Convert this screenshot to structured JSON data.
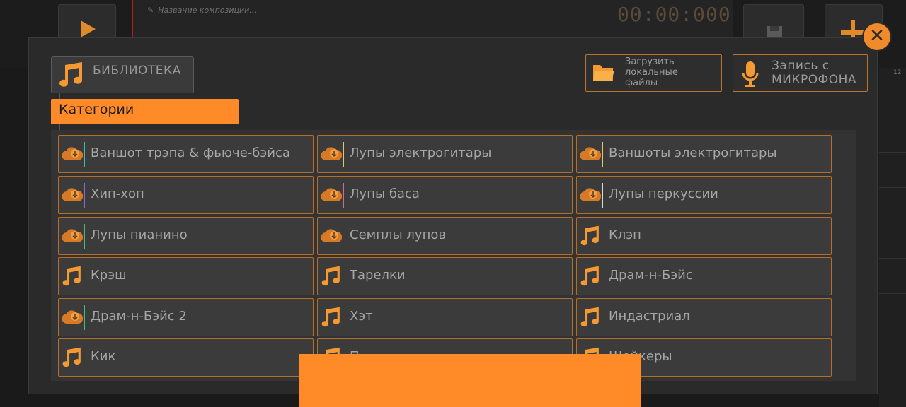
{
  "background": {
    "composition_placeholder": "Название композиции...",
    "timer": "00:00:000",
    "ruler_label": "12"
  },
  "toolbar": {
    "library_label": "БИБЛИОТЕКА",
    "load_label": "Загрузить\nлокальные\nфайлы",
    "mic_label": "Запись с\nМИКРОФОНА",
    "close_icon": "close-icon"
  },
  "categories_header": "Категории",
  "categories": [
    {
      "label": "Ваншот трэпа & фьюче-бэйса",
      "icon": "cloud-download-icon",
      "accent": "#3fb8a6"
    },
    {
      "label": "Лупы электрогитары",
      "icon": "cloud-download-icon",
      "accent": "#e0c860"
    },
    {
      "label": "Ваншоты электрогитары",
      "icon": "cloud-download-icon",
      "accent": "#e0c860"
    },
    {
      "label": "Хип-хоп",
      "icon": "cloud-download-icon",
      "accent": "#8a6cc8"
    },
    {
      "label": "Лупы баса",
      "icon": "cloud-download-icon",
      "accent": "#d06a9a"
    },
    {
      "label": "Лупы перкуссии",
      "icon": "cloud-download-icon",
      "accent": "#d8d8d8"
    },
    {
      "label": "Лупы пианино",
      "icon": "cloud-download-icon",
      "accent": "#4ab87a"
    },
    {
      "label": "Семплы лупов",
      "icon": "cloud-download-icon",
      "accent": "#3a3a3a"
    },
    {
      "label": "Клэп",
      "icon": "music-note-icon",
      "accent": "#3a3a3a"
    },
    {
      "label": "Крэш",
      "icon": "music-note-icon",
      "accent": "#3a3a3a"
    },
    {
      "label": "Тарелки",
      "icon": "music-note-icon",
      "accent": "#3a3a3a"
    },
    {
      "label": "Драм-н-Бэйс",
      "icon": "music-note-icon",
      "accent": "#3a3a3a"
    },
    {
      "label": "Драм-н-Бэйс 2",
      "icon": "cloud-download-icon",
      "accent": "#4ab87a"
    },
    {
      "label": "Хэт",
      "icon": "music-note-icon",
      "accent": "#3a3a3a"
    },
    {
      "label": "Индастриал",
      "icon": "music-note-icon",
      "accent": "#3a3a3a"
    },
    {
      "label": "Кик",
      "icon": "music-note-icon",
      "accent": "#3a3a3a"
    },
    {
      "label": "П…",
      "icon": "music-note-icon",
      "accent": "#3a3a3a"
    },
    {
      "label": "Шейкеры",
      "icon": "music-note-icon",
      "accent": "#3a3a3a"
    }
  ],
  "colors": {
    "accent": "#ff8a28",
    "tile_border": "#b46e2a",
    "icon_orange": "#f59a33"
  }
}
